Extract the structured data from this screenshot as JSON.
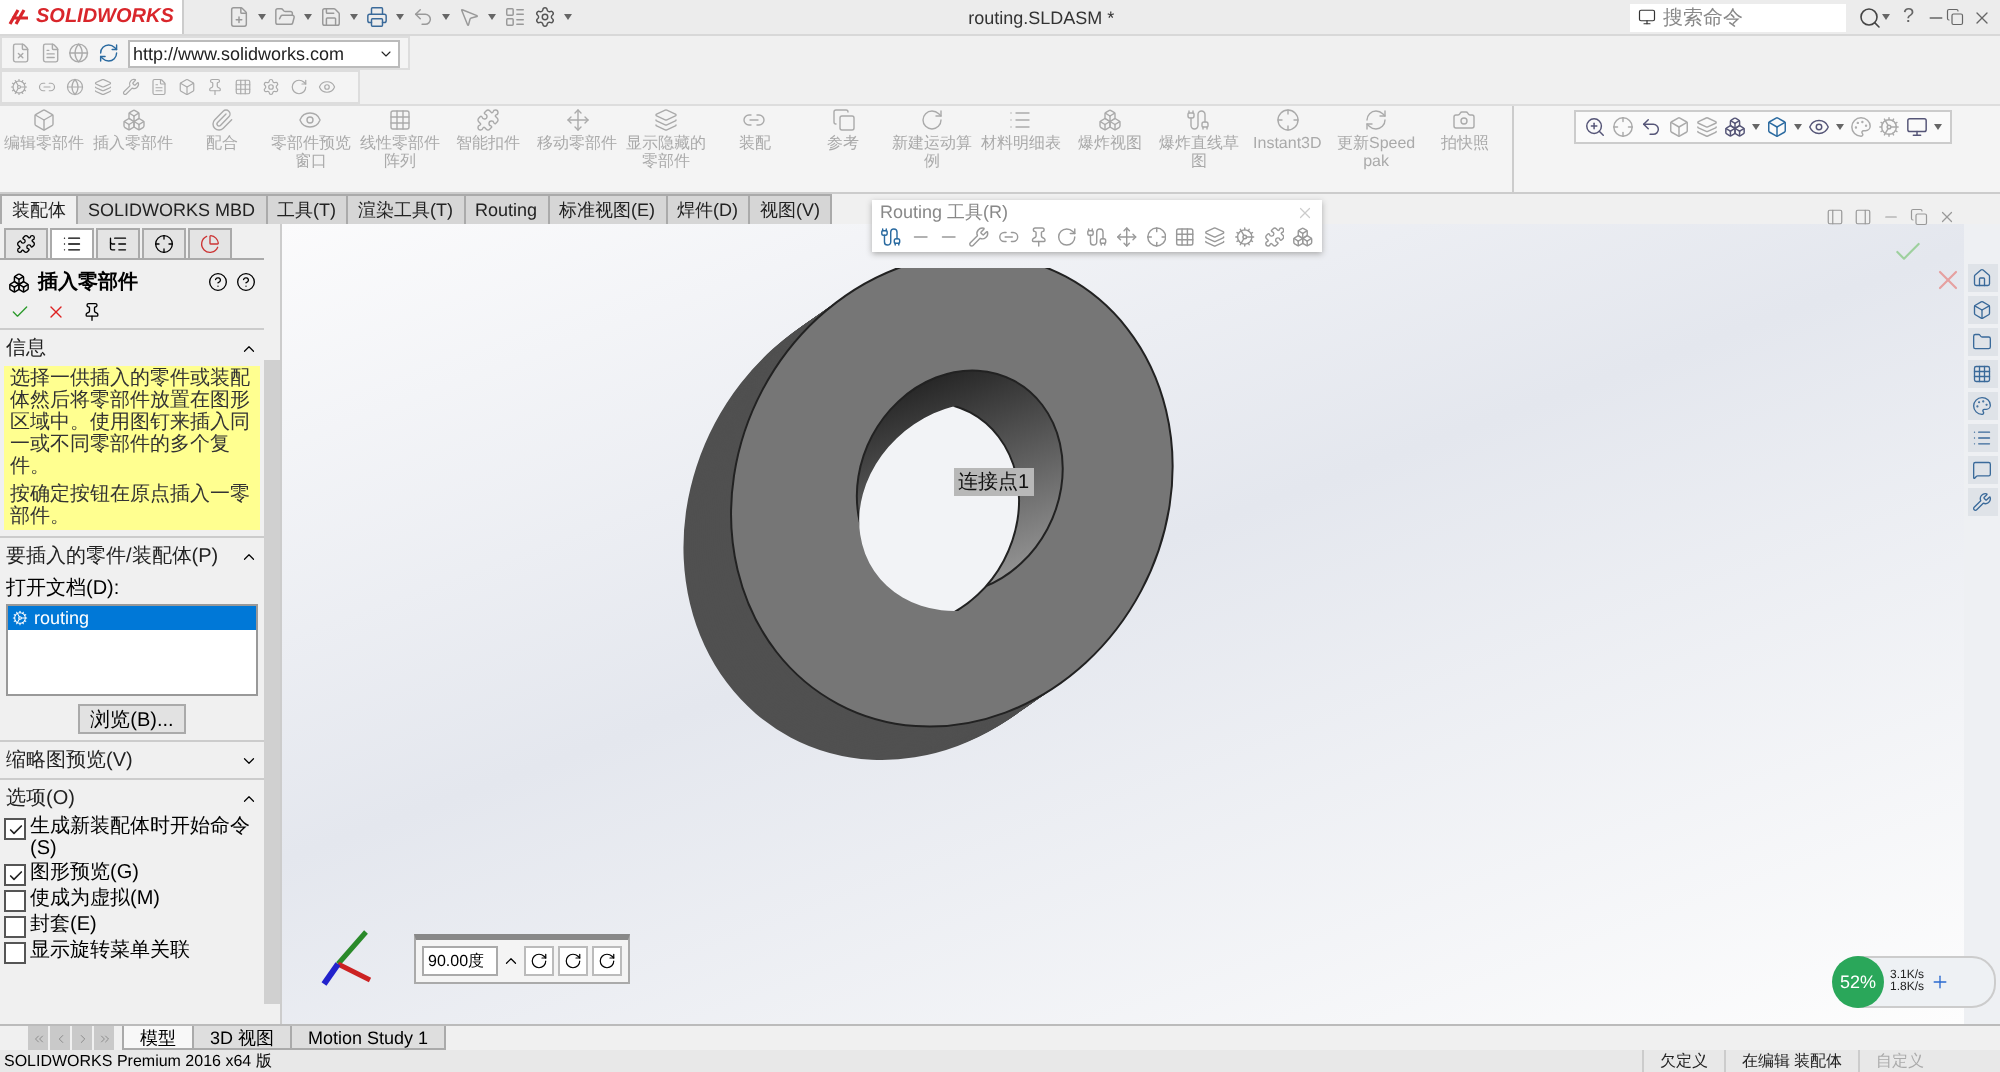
{
  "title_bar": {
    "app": "SOLIDWORKS",
    "title": "routing.SLDASM *",
    "search": {
      "placeholder": "搜索命令"
    },
    "help": "?"
  },
  "url_bar": {
    "value": "http://www.solidworks.com"
  },
  "command_manager": [
    {
      "label": "编辑零部件",
      "disabled": true
    },
    {
      "label": "插入零部件",
      "disabled": true
    },
    {
      "label": "配合",
      "disabled": true
    },
    {
      "label": "零部件预览窗口",
      "disabled": true
    },
    {
      "label": "线性零部件阵列",
      "disabled": true
    },
    {
      "label": "智能扣件",
      "disabled": true
    },
    {
      "label": "移动零部件",
      "disabled": true
    },
    {
      "label": "显示隐藏的零部件",
      "disabled": true
    },
    {
      "label": "装配",
      "disabled": true
    },
    {
      "label": "参考",
      "disabled": true
    },
    {
      "label": "新建运动算例",
      "disabled": true
    },
    {
      "label": "材料明细表",
      "disabled": true
    },
    {
      "label": "爆炸视图",
      "disabled": true
    },
    {
      "label": "爆炸直线草图",
      "disabled": true
    },
    {
      "label": "Instant3D",
      "disabled": true
    },
    {
      "label": "更新Speedpak",
      "disabled": true
    },
    {
      "label": "拍快照",
      "disabled": true
    }
  ],
  "tabs": [
    {
      "label": "装配体",
      "selected": true
    },
    {
      "label": "SOLIDWORKS MBD",
      "selected": false
    },
    {
      "label": "工具(T)",
      "selected": false
    },
    {
      "label": "渲染工具(T)",
      "selected": false
    },
    {
      "label": "Routing",
      "selected": false
    },
    {
      "label": "标准视图(E)",
      "selected": false
    },
    {
      "label": "焊件(D)",
      "selected": false
    },
    {
      "label": "视图(V)",
      "selected": false
    }
  ],
  "property_manager": {
    "title": "插入零部件",
    "info": {
      "title": "信息",
      "expanded": true,
      "text": "选择一供插入的零件或装配体然后将零部件放置在图形区域中。使用图钉来插入同一或不同零部件的多个复件。",
      "note": "按确定按钮在原点插入一零部件。"
    },
    "part_section": {
      "title": "要插入的零件/装配体(P)",
      "expanded": true,
      "open_docs_label": "打开文档(D):",
      "documents": [
        {
          "name": "routing",
          "selected": true
        }
      ],
      "browse": "浏览(B)..."
    },
    "thumbnail": {
      "title": "缩略图预览(V)",
      "expanded": false
    },
    "options": {
      "title": "选项(O)",
      "expanded": true,
      "items": [
        {
          "label": "生成新装配体时开始命令(S)",
          "checked": true
        },
        {
          "label": "图形预览(G)",
          "checked": true
        },
        {
          "label": "使成为虚拟(M)",
          "checked": false
        },
        {
          "label": "封套(E)",
          "checked": false
        },
        {
          "label": "显示旋转菜单关联",
          "checked": false
        }
      ]
    }
  },
  "viewport": {
    "routing_toolbar": {
      "title": "Routing 工具(R)"
    },
    "callout": "连接点1",
    "rotate": {
      "value": "90.00度"
    }
  },
  "network_widget": {
    "percent": "52%",
    "up": "3.1K/s",
    "down": "1.8K/s"
  },
  "bottom_tabs": [
    {
      "label": "模型",
      "selected": true
    },
    {
      "label": "3D 视图",
      "selected": false
    },
    {
      "label": "Motion Study 1",
      "selected": false
    }
  ],
  "status_bar": {
    "product": "SOLIDWORKS Premium 2016 x64 版",
    "items": [
      {
        "label": "欠定义",
        "disabled": false
      },
      {
        "label": "在编辑 装配体",
        "disabled": false
      },
      {
        "label": "自定义",
        "disabled": true
      }
    ]
  }
}
